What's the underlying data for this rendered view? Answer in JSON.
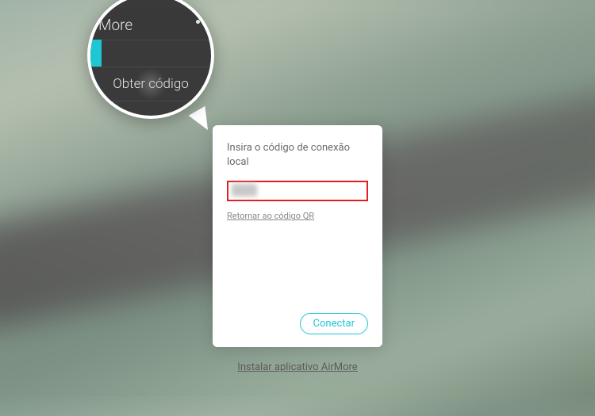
{
  "callout": {
    "header": "More",
    "item": "Obter código"
  },
  "card": {
    "title": "Insira o código de conexão local",
    "input_value": "",
    "qr_link": "Retornar ao código QR",
    "connect_label": "Conectar"
  },
  "footer": {
    "install_link": "Instalar aplicativo AirMore"
  },
  "colors": {
    "accent": "#1fc6d4",
    "input_border": "#e02020"
  }
}
